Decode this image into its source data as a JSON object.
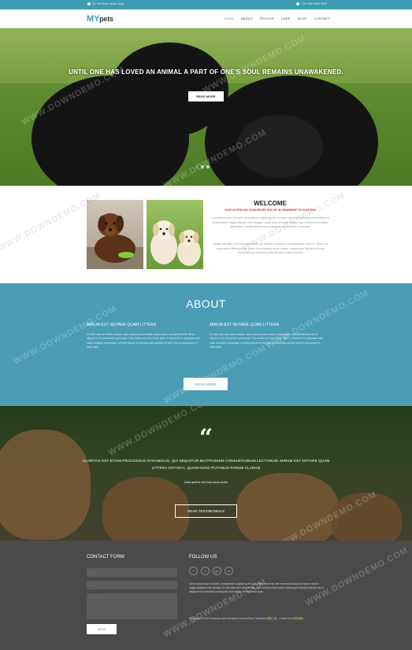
{
  "topbar": {
    "address": "28, Fire Rose Yellow Sky2",
    "phone": "+ 00 0000 0000 0000"
  },
  "header": {
    "logo_my": "MY",
    "logo_pets": "pets",
    "nav": [
      {
        "label": "HOME",
        "active": true
      },
      {
        "label": "ABOUT",
        "active": false
      },
      {
        "label": "PHOTOS",
        "active": false
      },
      {
        "label": "CARE",
        "active": false
      },
      {
        "label": "BLOG",
        "active": false
      },
      {
        "label": "CONTACT",
        "active": false
      }
    ]
  },
  "hero": {
    "title": "UNTIL ONE HAS LOVED AN ANIMAL A PART OF ONE'S SOUL REMAINS UNAWAKENED.",
    "button": "READ MORE",
    "slides": 3,
    "active_slide": 1
  },
  "welcome": {
    "title": "WELCOME",
    "subtitle": "DUIS AUTEM VEL EUM IRIURE DOLOR IN HENDRERIT IN VULPUTA",
    "para1": "Lorem ipsum dolor sit amet, consectetuer adipiscing elit, sed diam nonummy nibh euismod tincidunt ut laoreet dolore magna aliquam erat volutpat. Ut wisi enim ad minim veniam, quis nostrud exerci tation ullamcorper suscipit lobortis nisl ut aliquip ex ea commodo consequat.",
    "para2": "Claritas est etiam processus dynamicus, qui sequitur mutationem consuetudium lectorum. Mirum est notare quam littera gothica, quam nunc putamus parum claram, anteposuerit litterarum formas humanitatis per seacula quarta decima et quinta decima."
  },
  "about": {
    "title": "ABOUT",
    "col1_head": "MIRUM EST NOTARE QUAM LITTERA",
    "col1_text": "Ut wisi enim ad minim veniam, quis nostrud exerci tation ullamcorper suscipit lobortis nisl ut aliquip ex ea commodo consequat. Duis autem vel eum iriure dolor in hendrerit in vulputate velit esse molestie consequat, vel illum dolore eu feugiat nulla facilisis at vero eros et accumsan et iusto odio.",
    "col2_head": "MIRUM EST NOTARE QUAM LITTERA",
    "col2_text": "Ut wisi enim ad minim veniam, quis nostrud exerci tation ullamcorper suscipit lobortis nisl ut aliquip ex ea commodo consequat. Duis autem vel eum iriure dolor in hendrerit in vulputate velit esse molestie consequat, vel illum dolore eu feugiat nulla facilisis at vero eros et accumsan et iusto odio.",
    "button": "READ MORE"
  },
  "testimonial": {
    "quote_mark": "“",
    "text": "CLARITAS EST ETIAM PROCESSUS DYNAMICUS, QUI SEQUITUR MUTATIONEM CONSUETUDIUM LECTORUM. MIRUM EST NOTARE QUAM LITTERA GOTHICA, QUAM NUNC PUTAMUS PARUM CLARAM",
    "author": "Duis autem vel eum iriure dolor",
    "button": "READ TESTIMONIALS"
  },
  "footer": {
    "contact_title": "CONTACT FORM",
    "name_placeholder": "NAME",
    "email_placeholder": "EMAIL",
    "message_placeholder": "MESSAGE",
    "send": "SEND",
    "follow_title": "FOLLOW US",
    "social": [
      "f",
      "t",
      "g+",
      "in"
    ],
    "text": "Lorem ipsum dolor sit amet, consectetuer adipiscing elit, sed diam nonummy nibh euismod tincidunt ut laoreet dolore magna aliquam erat volutpat. Ut wisi enim ad minim veniam, quis nostrud exerci tation ullamcorper suscipit lobortis nisl ut aliquip ex ea commodo consequat. Duis autem vel eum iriure dolor.",
    "copyright": "Copyright © 2015 Company name All rights reserved More Templates",
    "copyright_link": "模板之家",
    "copyright_tail": "- Collect from",
    "copyright_link2": "网页模板"
  },
  "watermark": "WWW.DOWNDEMO.COM",
  "colors": {
    "accent": "#3d9bb2",
    "about_bg": "#4a9db4",
    "footer_bg": "#4a4a4a",
    "welcome_sub": "#c0392b"
  }
}
